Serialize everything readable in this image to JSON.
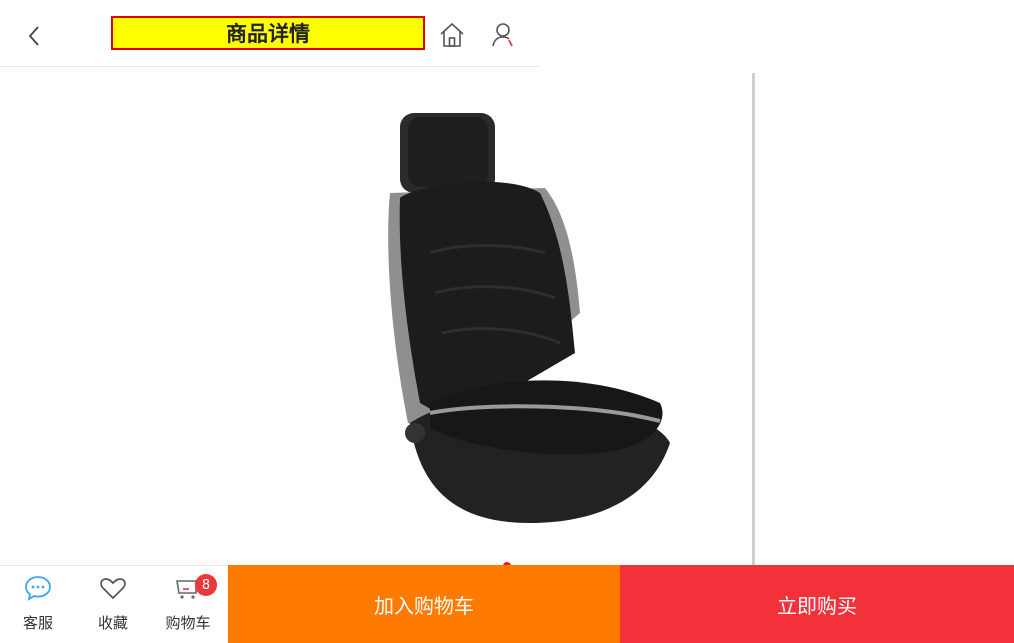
{
  "header": {
    "title": "商品详情",
    "back_icon": "chevron-left-icon",
    "home_icon": "home-icon",
    "user_icon": "user-icon"
  },
  "gallery": {
    "image": "car-seat-cushion-product-image",
    "indicator_color": "#ff1a1a"
  },
  "toolbar": {
    "service_label": "客服",
    "favorite_label": "收藏",
    "cart_label": "购物车",
    "cart_badge": "8"
  },
  "actions": {
    "add_to_cart": "加入购物车",
    "buy_now": "立即购买"
  },
  "colors": {
    "title_background": "#ffff00",
    "title_border": "#e00000",
    "add_to_cart": "#ff7a00",
    "buy_now": "#f2313b",
    "badge": "#e8393c",
    "service_icon": "#3aa7e8"
  }
}
